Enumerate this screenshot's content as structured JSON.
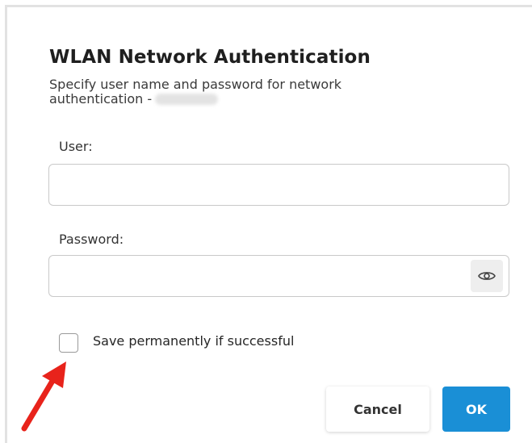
{
  "dialog": {
    "title": "WLAN Network Authentication",
    "description": "Specify user name and password for network authentication -"
  },
  "user_field": {
    "label": "User:",
    "value": ""
  },
  "password_field": {
    "label": "Password:",
    "value": "",
    "toggle_icon": "eye-icon"
  },
  "save_option": {
    "label": "Save permanently if successful",
    "checked": false
  },
  "buttons": {
    "cancel_label": "Cancel",
    "ok_label": "OK"
  },
  "annotation": {
    "icon": "red-arrow-icon",
    "color": "#e8231b"
  },
  "colors": {
    "accent": "#1a8fd6"
  }
}
